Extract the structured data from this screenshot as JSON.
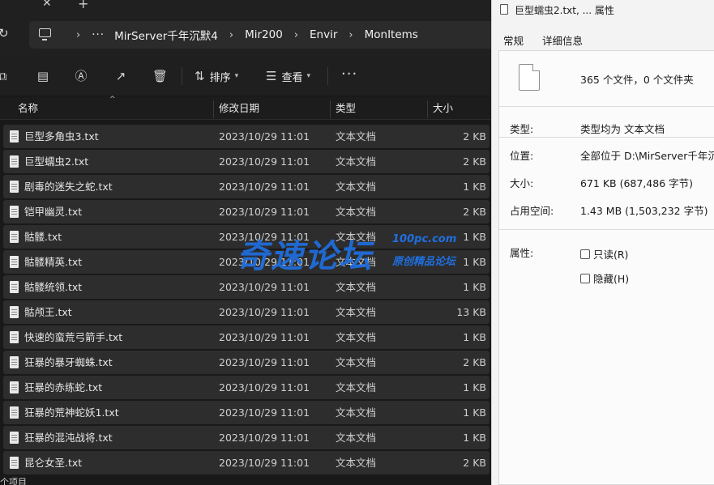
{
  "explorer": {
    "address": {
      "crumbs": [
        "MirServer千年沉默4",
        "Mir200",
        "Envir",
        "MonItems"
      ],
      "overflow": "···"
    },
    "toolbar": {
      "sort_label": "排序",
      "view_label": "查看",
      "more_label": "···"
    },
    "columns": {
      "name": "名称",
      "date": "修改日期",
      "type": "类型",
      "size": "大小"
    },
    "files": [
      {
        "name": "巨型多角虫3.txt",
        "date": "2023/10/29 11:01",
        "type": "文本文档",
        "size": "2 KB"
      },
      {
        "name": "巨型蠕虫2.txt",
        "date": "2023/10/29 11:01",
        "type": "文本文档",
        "size": "2 KB"
      },
      {
        "name": "剧毒的迷失之蛇.txt",
        "date": "2023/10/29 11:01",
        "type": "文本文档",
        "size": "1 KB"
      },
      {
        "name": "铠甲幽灵.txt",
        "date": "2023/10/29 11:01",
        "type": "文本文档",
        "size": "2 KB"
      },
      {
        "name": "骷髅.txt",
        "date": "2023/10/29 11:01",
        "type": "文本文档",
        "size": "1 KB"
      },
      {
        "name": "骷髅精英.txt",
        "date": "2023/10/29 11:01",
        "type": "文本文档",
        "size": "1 KB"
      },
      {
        "name": "骷髅统领.txt",
        "date": "2023/10/29 11:01",
        "type": "文本文档",
        "size": "1 KB"
      },
      {
        "name": "骷颅王.txt",
        "date": "2023/10/29 11:01",
        "type": "文本文档",
        "size": "13 KB"
      },
      {
        "name": "快速的蛮荒弓箭手.txt",
        "date": "2023/10/29 11:01",
        "type": "文本文档",
        "size": "1 KB"
      },
      {
        "name": "狂暴的暴牙蜘蛛.txt",
        "date": "2023/10/29 11:01",
        "type": "文本文档",
        "size": "2 KB"
      },
      {
        "name": "狂暴的赤练蛇.txt",
        "date": "2023/10/29 11:01",
        "type": "文本文档",
        "size": "1 KB"
      },
      {
        "name": "狂暴的荒神蛇妖1.txt",
        "date": "2023/10/29 11:01",
        "type": "文本文档",
        "size": "1 KB"
      },
      {
        "name": "狂暴的混沌战将.txt",
        "date": "2023/10/29 11:01",
        "type": "文本文档",
        "size": "1 KB"
      },
      {
        "name": "昆仑女圣.txt",
        "date": "2023/10/29 11:01",
        "type": "文本文档",
        "size": "2 KB"
      }
    ],
    "status": "个项目"
  },
  "watermark": {
    "main": "奇速论坛",
    "top": "100pc.com",
    "bottom": "原创精品论坛"
  },
  "properties": {
    "title": "巨型蠕虫2.txt, ... 属性",
    "tabs": {
      "general": "常规",
      "details": "详细信息"
    },
    "count": "365 个文件，0 个文件夹",
    "type_label": "类型:",
    "type_value": "类型均为 文本文档",
    "location_label": "位置:",
    "location_value": "全部位于 D:\\MirServer千年沉默",
    "size_label": "大小:",
    "size_value": "671 KB (687,486 字节)",
    "disk_label": "占用空间:",
    "disk_value": "1.43 MB (1,503,232 字节)",
    "attr_label": "属性:",
    "readonly_label": "只读(R)",
    "hidden_label": "隐藏(H)"
  }
}
